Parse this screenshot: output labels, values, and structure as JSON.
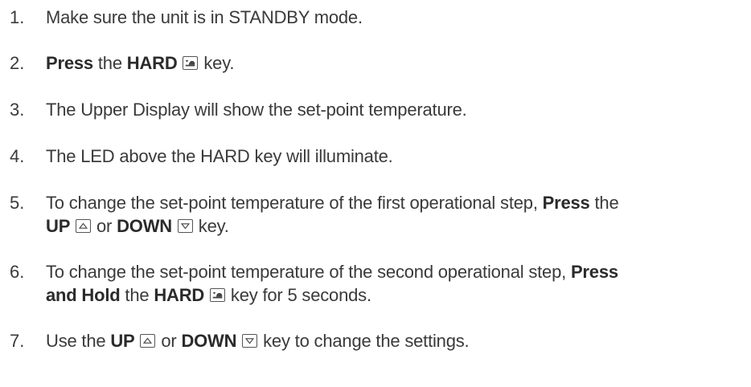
{
  "steps": [
    {
      "number": "1.",
      "text_a": "Make sure the unit is in STANDBY mode."
    },
    {
      "number": "2.",
      "press": "Press",
      "the": " the ",
      "hard": "HARD",
      "key_word": " key."
    },
    {
      "number": "3.",
      "text_a": "The Upper Display will show the set-point temperature."
    },
    {
      "number": "4.",
      "text_a": "The LED above the HARD key will illuminate."
    },
    {
      "number": "5.",
      "text_a": "To change the set-point temperature of the first operational step, ",
      "press": "Press",
      "the": " the",
      "up": "UP",
      "or": " or ",
      "down": "DOWN",
      "key_word": " key."
    },
    {
      "number": "6.",
      "text_a": "To change the set-point temperature of the second operational step, ",
      "press_hold_a": "Press",
      "press_hold_b": "and Hold",
      "the": " the ",
      "hard": "HARD",
      "key_word": " key for 5 seconds."
    },
    {
      "number": "7.",
      "text_a": "Use the ",
      "up": "UP",
      "or": " or ",
      "down": "DOWN",
      "key_word": " key to change the settings."
    }
  ],
  "icons": {
    "hard_key": "hard-key-icon",
    "up_key": "up-arrow-key-icon",
    "down_key": "down-arrow-key-icon"
  }
}
